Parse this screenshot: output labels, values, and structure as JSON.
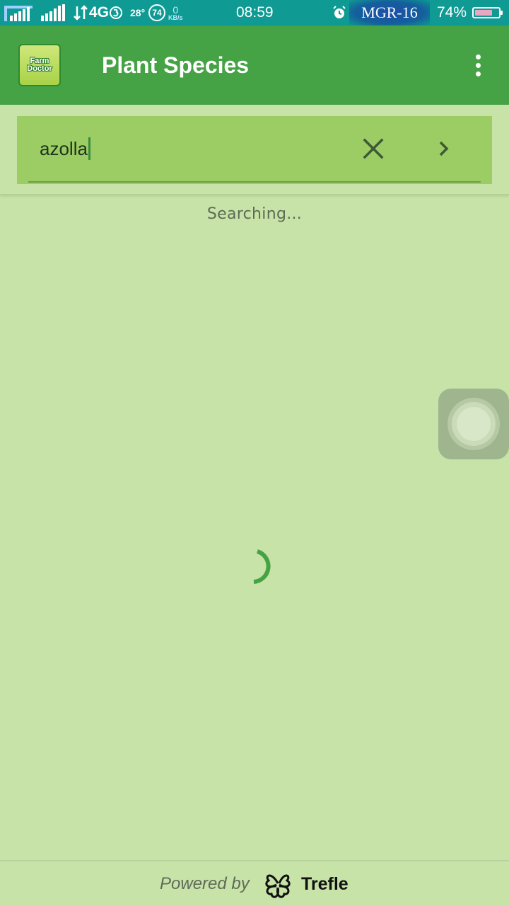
{
  "status_bar": {
    "network": "4G",
    "temperature": "28°",
    "aqi": "74",
    "speed_value": "0",
    "speed_unit": "KB/s",
    "time": "08:59",
    "carrier": "MGR-16",
    "battery_percent": "74%",
    "battery_level": 0.74
  },
  "app_bar": {
    "logo_line1": "Farm",
    "logo_line2": "Doctor",
    "title": "Plant Species"
  },
  "search": {
    "value": "azolla"
  },
  "content": {
    "status_text": "Searching..."
  },
  "footer": {
    "powered_by": "Powered by",
    "brand": "Trefle"
  },
  "colors": {
    "status_bar": "#0f9b93",
    "app_bar": "#45a245",
    "background": "#c8e3a7",
    "search_box": "#9ccd65",
    "spinner": "#45a245"
  },
  "icons": {
    "clear": "close-icon",
    "go": "chevron-right-icon",
    "menu": "more-vert-icon",
    "brand": "trefle-icon"
  }
}
